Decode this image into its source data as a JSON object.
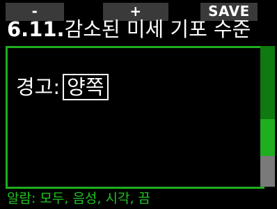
{
  "softkeys": {
    "left": "-",
    "middle": "+",
    "right": "SAVE"
  },
  "title": {
    "number": "6.11.",
    "text": "감소된 미세 기포 수준"
  },
  "setting": {
    "label": "경고:",
    "value": "양쪽"
  },
  "scroll": {
    "position_fraction": 0.78,
    "size_fraction": 0.22
  },
  "footer": {
    "text": "알람: 모두, 음성, 시각, 끔"
  },
  "colors": {
    "accent_green": "#1fae1f",
    "footer_green": "#22c422",
    "softkey_bg": "#3a3a3a",
    "background": "#000000"
  }
}
